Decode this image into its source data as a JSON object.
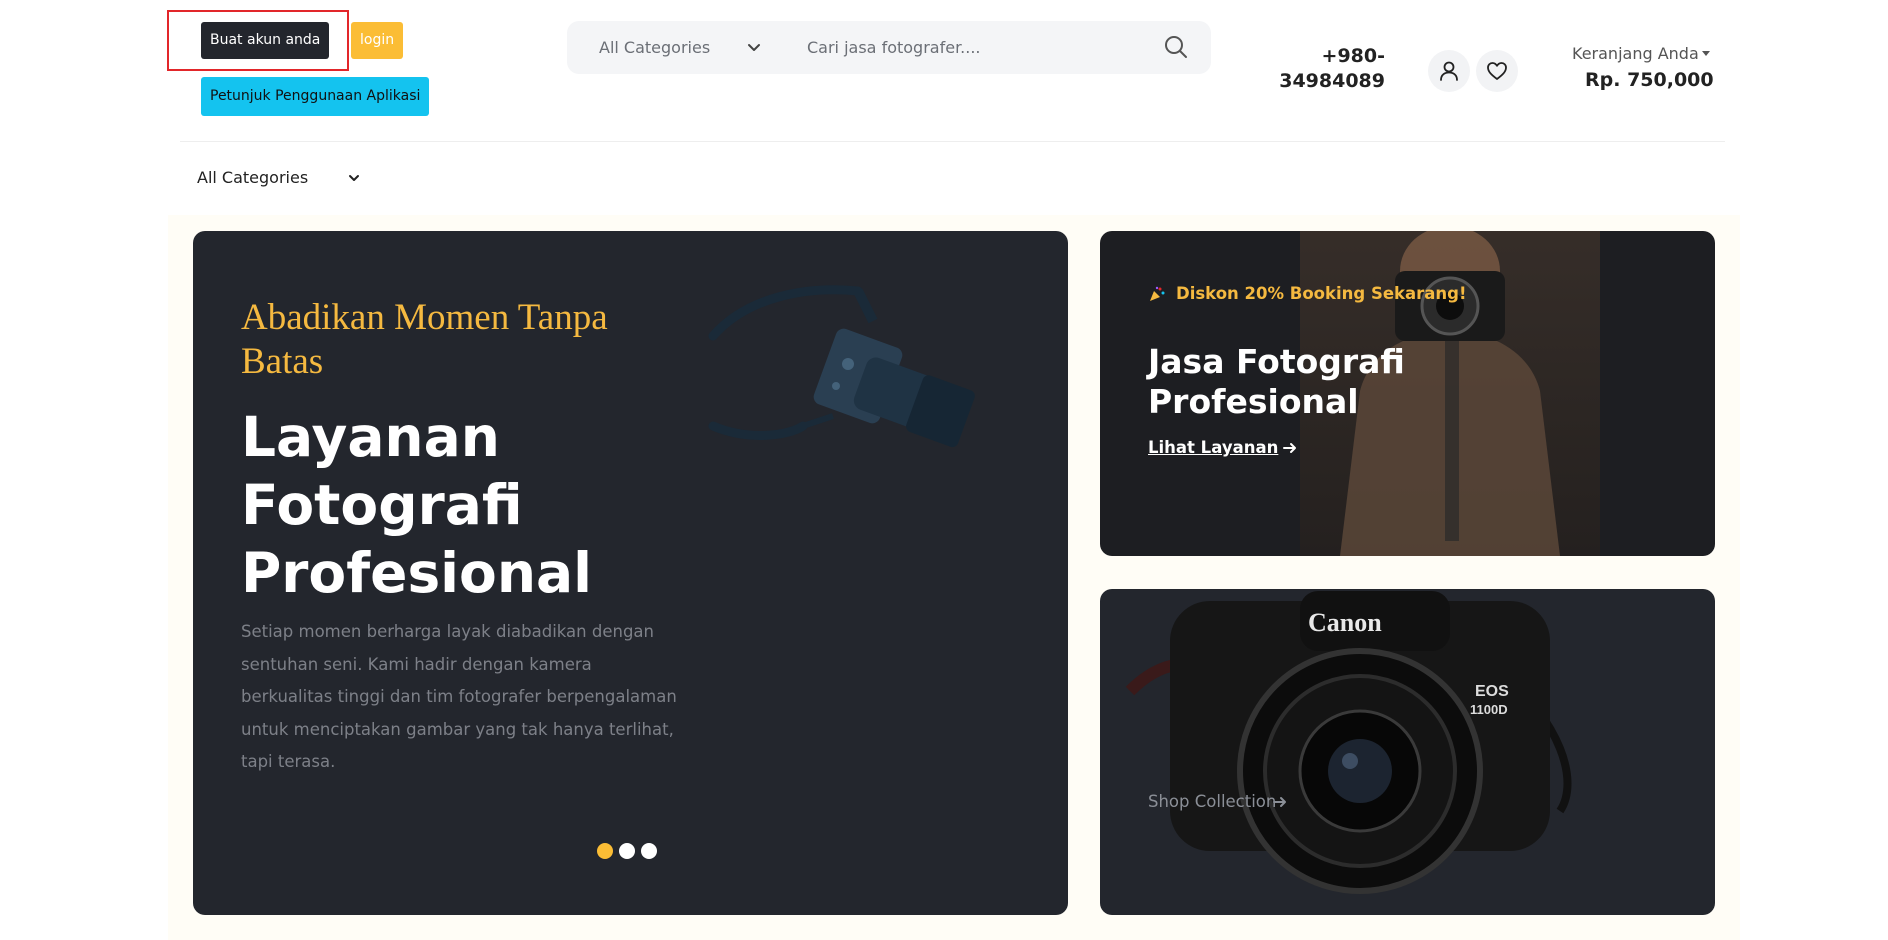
{
  "header": {
    "register_label": "Buat akun anda",
    "login_label": "login",
    "guide_label": "Petunjuk Penggunaan Aplikasi",
    "search": {
      "category": "All Categories",
      "placeholder": "Cari jasa fotografer...."
    },
    "phone": "+980-34984089",
    "cart_label": "Keranjang Anda",
    "cart_total": "Rp. 750,000"
  },
  "category_menu": {
    "selected": "All Categories"
  },
  "hero": {
    "kicker": "Abadikan Momen Tanpa Batas",
    "title": "Layanan Fotografi Profesional",
    "description": "Setiap momen berharga layak diabadikan dengan sentuhan seni. Kami hadir dengan kamera berkualitas tinggi dan tim fotografer berpengalaman untuk menciptakan gambar yang tak hanya terlihat, tapi terasa.",
    "slides_count": 3,
    "active_slide": 1
  },
  "promo_top": {
    "badge": "Diskon 20% Booking Sekarang!",
    "title": "Jasa Fotografi Profesional",
    "link_label": "Lihat Layanan"
  },
  "promo_bottom": {
    "link_label": "Shop Collection"
  },
  "colors": {
    "accent_yellow": "#fbbd35",
    "accent_cyan": "#14c3ef",
    "dark": "#23262d",
    "highlight_red": "#e2262a"
  },
  "icons": {
    "search": "search-icon",
    "user": "user-icon",
    "heart": "heart-icon",
    "chevron": "chevron-down-icon",
    "arrow": "arrow-right-icon",
    "party": "party-popper-icon"
  }
}
